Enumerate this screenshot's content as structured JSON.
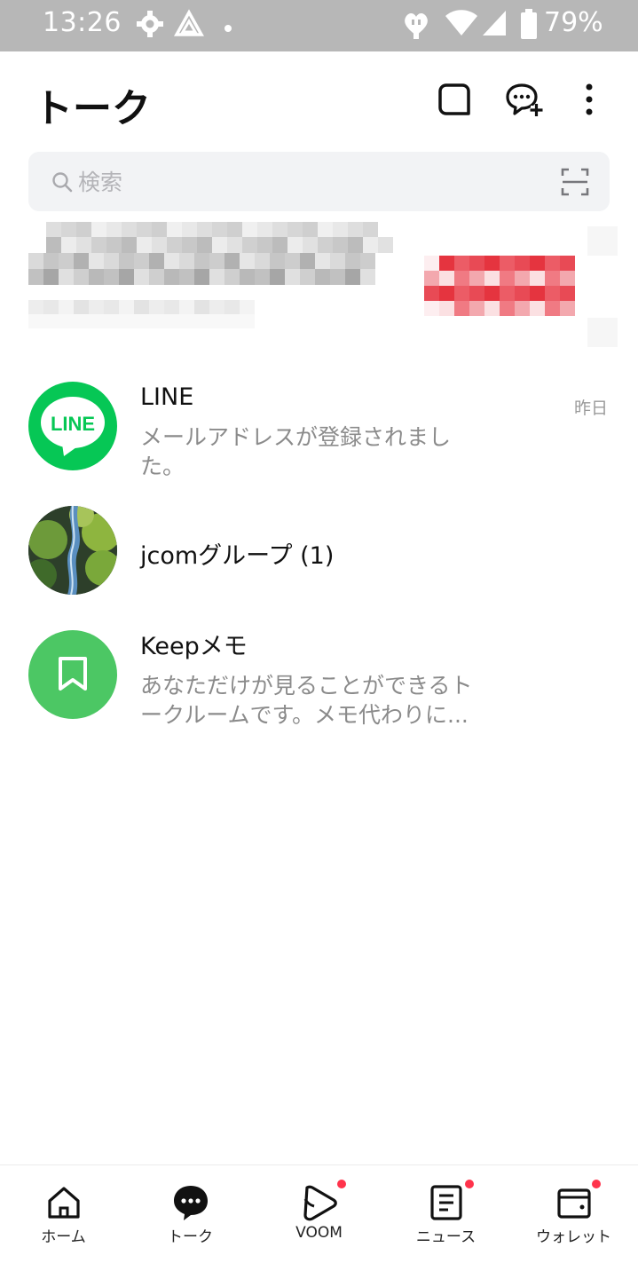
{
  "status_bar": {
    "time": "13:26",
    "battery_percent": "79%",
    "icons": [
      "gear-icon",
      "drive-icon",
      "dot-icon",
      "heart-plug-icon",
      "wifi-icon",
      "signal-icon",
      "battery-icon"
    ]
  },
  "header": {
    "title": "トーク",
    "actions": [
      "edit-icon",
      "new-chat-icon",
      "more-icon"
    ]
  },
  "search": {
    "placeholder": "検索",
    "scan_icon": "qr-scan-icon"
  },
  "chats": [
    {
      "name": "LINE",
      "message": "メールアドレスが登録されました。",
      "time": "昨日",
      "avatar": "line-logo",
      "avatar_text": "LINE"
    },
    {
      "name": "jcomグループ (1)",
      "message": "",
      "time": "",
      "avatar": "waterfall-photo"
    },
    {
      "name": "Keepメモ",
      "message": "あなただけが見ることができるトークルームです。メモ代わりに...",
      "time": "",
      "avatar": "bookmark-icon"
    }
  ],
  "bottom_nav": [
    {
      "label": "ホーム",
      "icon": "home-icon",
      "badge": false
    },
    {
      "label": "トーク",
      "icon": "talk-icon",
      "badge": false,
      "active": true
    },
    {
      "label": "VOOM",
      "icon": "voom-icon",
      "badge": true
    },
    {
      "label": "ニュース",
      "icon": "news-icon",
      "badge": true
    },
    {
      "label": "ウォレット",
      "icon": "wallet-icon",
      "badge": true
    }
  ],
  "colors": {
    "line_green": "#06c755",
    "keep_green": "#4cc764",
    "badge_red": "#ff334b",
    "status_bar": "#b7b7b7"
  }
}
